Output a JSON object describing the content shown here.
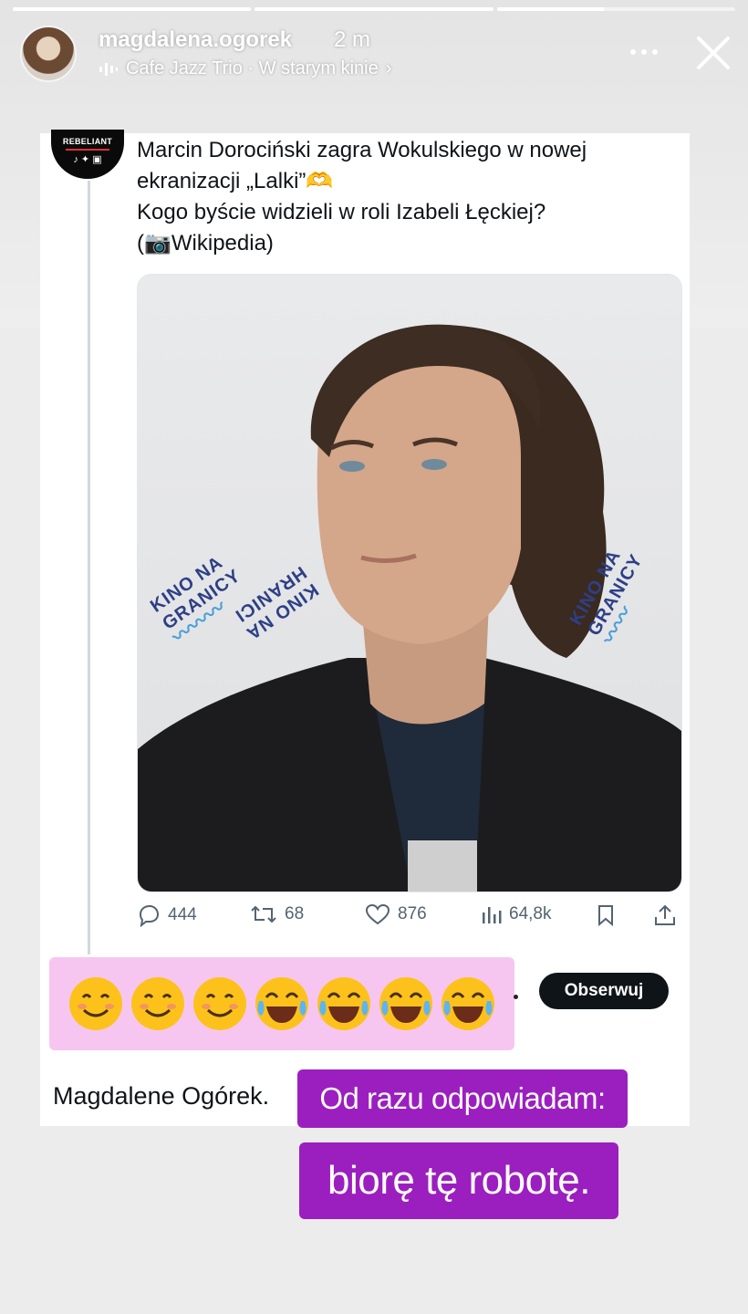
{
  "story": {
    "progress": [
      1,
      1,
      0.45
    ],
    "username": "magdalena.ogorek",
    "time_ago": "2 m",
    "music": "Cafe Jazz Trio · W starym kinie",
    "music_chevron": "›"
  },
  "tweet": {
    "account_brand": "REBELIANT",
    "lines": [
      "Marcin Dorociński zagra Wokulskiego w nowej",
      "ekranizacji „Lalki”🫶",
      "Kogo byście widzieli w roli Izabeli Łęckiej?",
      "(📷Wikipedia)"
    ],
    "photo_logo_lines": [
      "KINO NA",
      "GRANICY",
      "HRANICI",
      "KINO NA"
    ],
    "actions": {
      "replies": "444",
      "retweets": "68",
      "likes": "876",
      "views": "64,8k"
    }
  },
  "comment": {
    "emojis": [
      "😊",
      "😊",
      "😊",
      "😂",
      "😂",
      "😂",
      "😂"
    ],
    "follow_label": "Obserwuj",
    "author_text": "Magdalene Ogórek."
  },
  "stickers": {
    "line1": "Od razu odpowiadam:",
    "line2": "biorę tę robotę."
  },
  "colors": {
    "sticker_bg": "#9b1fbf",
    "emoji_box_bg": "#f6c6f0",
    "follow_bg": "#0f1419"
  }
}
